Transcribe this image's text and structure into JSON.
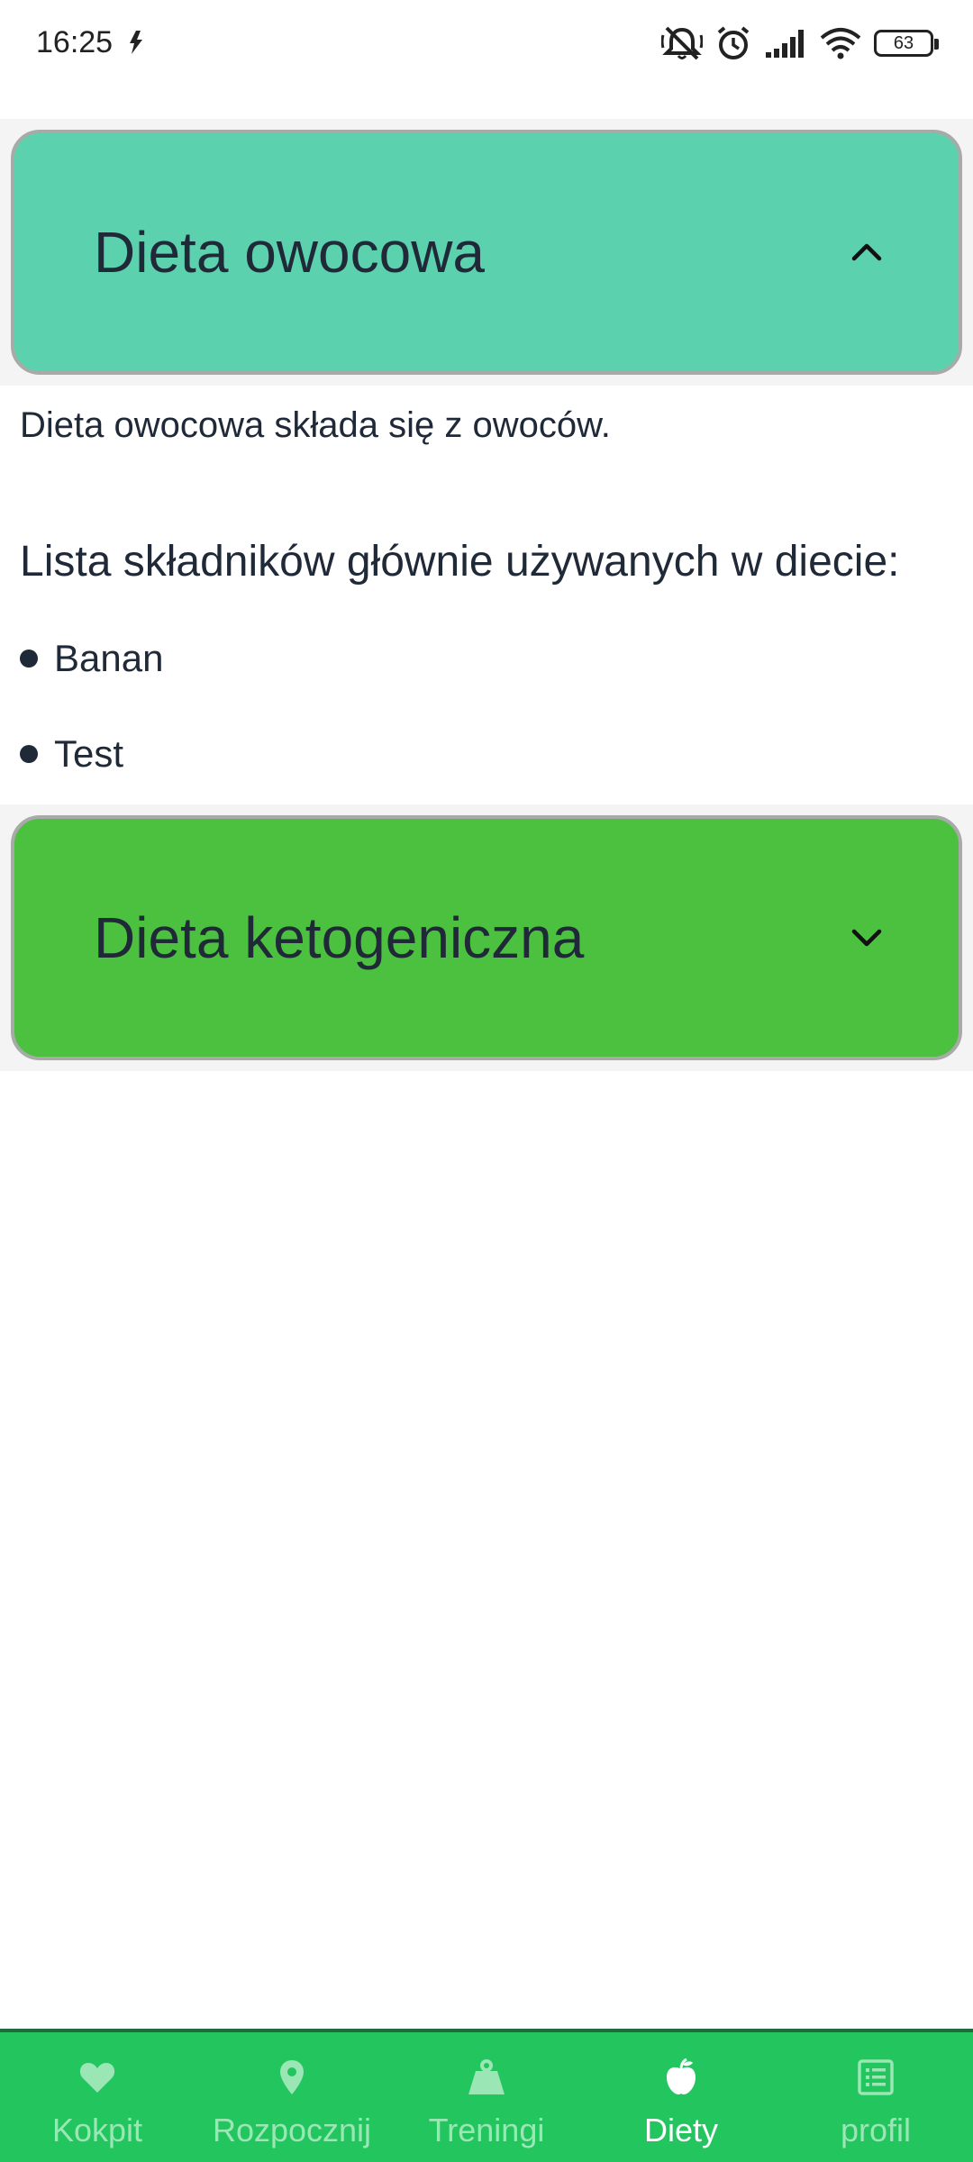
{
  "status_bar": {
    "time": "16:25",
    "battery": "63",
    "icons": [
      "mute-icon",
      "alarm-icon",
      "signal-icon",
      "wifi-icon",
      "battery-icon"
    ]
  },
  "diets": [
    {
      "title": "Dieta owocowa",
      "expanded": true,
      "color": "#5bd1ad",
      "description": "Dieta owocowa składa się z owoców.",
      "ingredients_label": "Lista składników głównie używanych w diecie:",
      "ingredients": [
        "Banan",
        "Test"
      ]
    },
    {
      "title": "Dieta ketogeniczna",
      "expanded": false,
      "color": "#4cc03f"
    }
  ],
  "bottom_nav": {
    "active": "Diety",
    "background": "#22c55e",
    "items": [
      {
        "label": "Kokpit",
        "icon": "heart-icon"
      },
      {
        "label": "Rozpocznij",
        "icon": "location-pin-icon"
      },
      {
        "label": "Treningi",
        "icon": "weight-icon"
      },
      {
        "label": "Diety",
        "icon": "apple-icon"
      },
      {
        "label": "profil",
        "icon": "list-icon"
      }
    ]
  }
}
